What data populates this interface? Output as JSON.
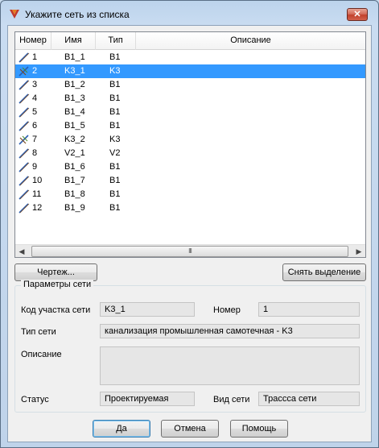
{
  "window": {
    "title": "Укажите сеть из списка",
    "close_glyph": "✕"
  },
  "list": {
    "columns": [
      "Номер",
      "Имя",
      "Тип",
      "Описание"
    ],
    "rows": [
      {
        "num": "1",
        "name": "B1_1",
        "type": "B1",
        "desc": "",
        "icon": "pipe-icon"
      },
      {
        "num": "2",
        "name": "K3_1",
        "type": "K3",
        "desc": "",
        "icon": "sewer-pipe-icon"
      },
      {
        "num": "3",
        "name": "B1_2",
        "type": "B1",
        "desc": "",
        "icon": "pipe-icon"
      },
      {
        "num": "4",
        "name": "B1_3",
        "type": "B1",
        "desc": "",
        "icon": "pipe-icon"
      },
      {
        "num": "5",
        "name": "B1_4",
        "type": "B1",
        "desc": "",
        "icon": "pipe-icon"
      },
      {
        "num": "6",
        "name": "B1_5",
        "type": "B1",
        "desc": "",
        "icon": "pipe-icon"
      },
      {
        "num": "7",
        "name": "K3_2",
        "type": "K3",
        "desc": "",
        "icon": "sewer-pipe-icon"
      },
      {
        "num": "8",
        "name": "V2_1",
        "type": "V2",
        "desc": "",
        "icon": "pipe-icon"
      },
      {
        "num": "9",
        "name": "B1_6",
        "type": "B1",
        "desc": "",
        "icon": "pipe-icon"
      },
      {
        "num": "10",
        "name": "B1_7",
        "type": "B1",
        "desc": "",
        "icon": "pipe-icon"
      },
      {
        "num": "11",
        "name": "B1_8",
        "type": "B1",
        "desc": "",
        "icon": "pipe-icon"
      },
      {
        "num": "12",
        "name": "B1_9",
        "type": "B1",
        "desc": "",
        "icon": "pipe-icon"
      }
    ],
    "selected_index": 1,
    "scroll_thumb_glyph": "III"
  },
  "buttons": {
    "drawing": "Чертеж...",
    "clear_selection": "Снять выделение",
    "ok": "Да",
    "cancel": "Отмена",
    "help": "Помощь"
  },
  "params": {
    "group_title": "Параметры сети",
    "section_code_label": "Код участка сети",
    "section_code_value": "K3_1",
    "number_label": "Номер",
    "number_value": "1",
    "net_type_label": "Тип сети",
    "net_type_value": "канализация промышленная самотечная - K3",
    "description_label": "Описание",
    "description_value": "",
    "status_label": "Статус",
    "status_value": "Проектируемая",
    "net_kind_label": "Вид сети",
    "net_kind_value": "Трассса сети"
  },
  "colors": {
    "selection": "#3399ff",
    "pipe_blue": "#2a5db0",
    "pipe_green": "#4a8a2a",
    "pipe_brown": "#7a4a22"
  }
}
